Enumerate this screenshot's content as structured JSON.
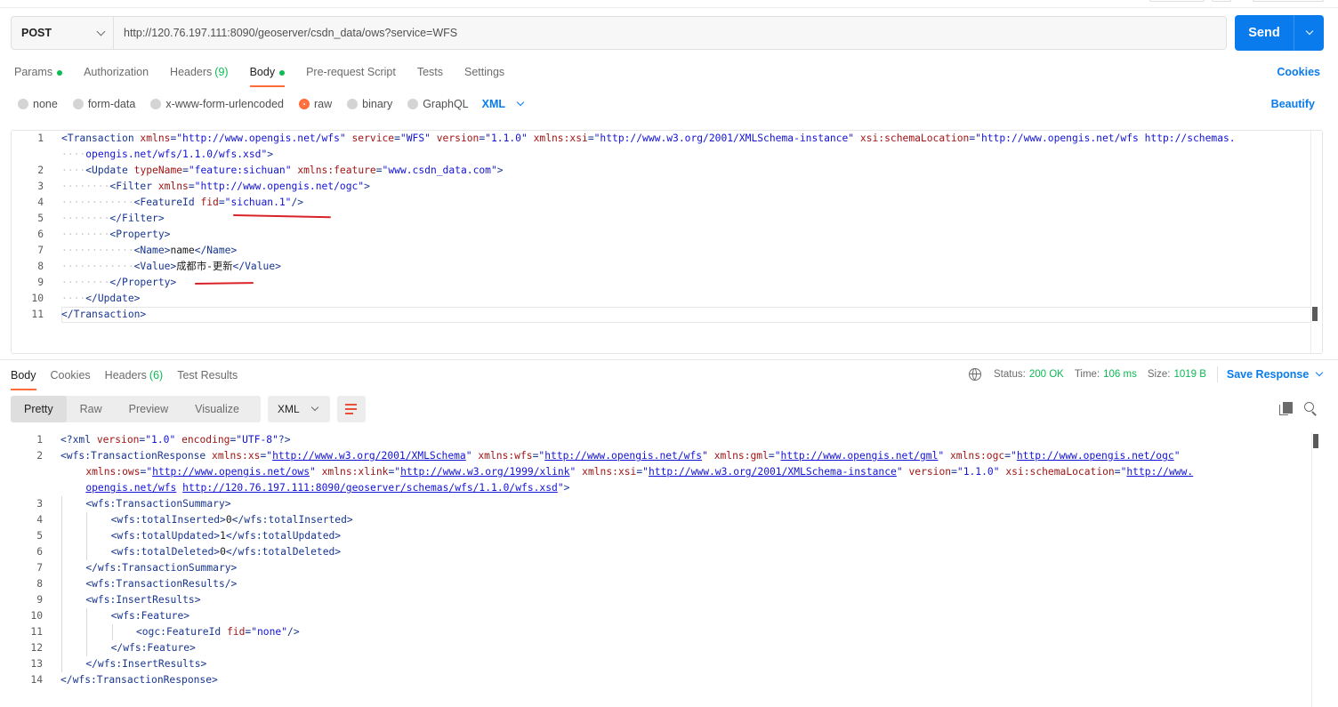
{
  "request": {
    "method": "POST",
    "url": "http://120.76.197.111:8090/geoserver/csdn_data/ows?service=WFS",
    "send_label": "Send"
  },
  "request_tabs": [
    {
      "label": "Params",
      "dot": true
    },
    {
      "label": "Authorization"
    },
    {
      "label": "Headers",
      "count": "(9)"
    },
    {
      "label": "Body",
      "dot": true,
      "active": true
    },
    {
      "label": "Pre-request Script"
    },
    {
      "label": "Tests"
    },
    {
      "label": "Settings"
    }
  ],
  "cookies_label": "Cookies",
  "body_types": [
    {
      "label": "none"
    },
    {
      "label": "form-data"
    },
    {
      "label": "x-www-form-urlencoded"
    },
    {
      "label": "raw",
      "selected": true
    },
    {
      "label": "binary"
    },
    {
      "label": "GraphQL"
    }
  ],
  "body_language": "XML",
  "beautify_label": "Beautify",
  "request_lines": [
    {
      "n": "1",
      "indent": 0,
      "parts": [
        [
          "tg",
          "<Transaction "
        ],
        [
          "at",
          "xmlns"
        ],
        [
          "tg",
          "="
        ],
        [
          "vl",
          "\"http://www.opengis.net/wfs\""
        ],
        [
          "tg",
          " "
        ],
        [
          "at",
          "service"
        ],
        [
          "tg",
          "="
        ],
        [
          "vl",
          "\"WFS\""
        ],
        [
          "tg",
          " "
        ],
        [
          "at",
          "version"
        ],
        [
          "tg",
          "="
        ],
        [
          "vl",
          "\"1.1.0\""
        ],
        [
          "tg",
          " "
        ],
        [
          "at",
          "xmlns:xsi"
        ],
        [
          "tg",
          "="
        ],
        [
          "vl",
          "\"http://www.w3.org/2001/XMLSchema-instance\""
        ],
        [
          "tg",
          " "
        ],
        [
          "at",
          "xsi:schemaLocation"
        ],
        [
          "tg",
          "="
        ],
        [
          "vl",
          "\"http://www.opengis.net/wfs http://schemas."
        ]
      ]
    },
    {
      "n": "",
      "indent": 4,
      "parts": [
        [
          "vl",
          "opengis.net/wfs/1.1.0/wfs.xsd\""
        ],
        [
          "tg",
          ">"
        ]
      ]
    },
    {
      "n": "2",
      "indent": 4,
      "parts": [
        [
          "tg",
          "<Update "
        ],
        [
          "at",
          "typeName"
        ],
        [
          "tg",
          "="
        ],
        [
          "vl",
          "\"feature:sichuan\""
        ],
        [
          "tg",
          " "
        ],
        [
          "at",
          "xmlns:feature"
        ],
        [
          "tg",
          "="
        ],
        [
          "vl",
          "\"www.csdn_data.com\""
        ],
        [
          "tg",
          ">"
        ]
      ]
    },
    {
      "n": "3",
      "indent": 8,
      "parts": [
        [
          "tg",
          "<Filter "
        ],
        [
          "at",
          "xmlns"
        ],
        [
          "tg",
          "="
        ],
        [
          "vl",
          "\"http://www.opengis.net/ogc\""
        ],
        [
          "tg",
          ">"
        ]
      ]
    },
    {
      "n": "4",
      "indent": 12,
      "parts": [
        [
          "tg",
          "<FeatureId "
        ],
        [
          "at",
          "fid"
        ],
        [
          "tg",
          "="
        ],
        [
          "vl",
          "\"sichuan.1\""
        ],
        [
          "tg",
          "/>"
        ]
      ]
    },
    {
      "n": "5",
      "indent": 8,
      "parts": [
        [
          "tg",
          "</Filter>"
        ]
      ]
    },
    {
      "n": "6",
      "indent": 8,
      "parts": [
        [
          "tg",
          "<Property>"
        ]
      ]
    },
    {
      "n": "7",
      "indent": 12,
      "parts": [
        [
          "tg",
          "<Name>"
        ],
        [
          "tx",
          "name"
        ],
        [
          "tg",
          "</Name>"
        ]
      ]
    },
    {
      "n": "8",
      "indent": 12,
      "parts": [
        [
          "tg",
          "<Value>"
        ],
        [
          "tx",
          "成都市-更新"
        ],
        [
          "tg",
          "</Value>"
        ]
      ]
    },
    {
      "n": "9",
      "indent": 8,
      "parts": [
        [
          "tg",
          "</Property>"
        ]
      ]
    },
    {
      "n": "10",
      "indent": 4,
      "parts": [
        [
          "tg",
          "</Update>"
        ]
      ]
    },
    {
      "n": "11",
      "indent": 0,
      "parts": [
        [
          "tg",
          "</Transaction>"
        ]
      ]
    }
  ],
  "response_tabs": [
    {
      "label": "Body",
      "active": true
    },
    {
      "label": "Cookies"
    },
    {
      "label": "Headers",
      "count": "(6)"
    },
    {
      "label": "Test Results"
    }
  ],
  "status": {
    "status_label": "Status:",
    "status_value": "200 OK",
    "time_label": "Time:",
    "time_value": "106 ms",
    "size_label": "Size:",
    "size_value": "1019 B",
    "save_response": "Save Response"
  },
  "view_modes": [
    {
      "label": "Pretty",
      "active": true
    },
    {
      "label": "Raw"
    },
    {
      "label": "Preview"
    },
    {
      "label": "Visualize"
    }
  ],
  "response_format": "XML",
  "response_lines": [
    {
      "n": "1",
      "indent": 0,
      "parts": [
        [
          "tg",
          "<?xml "
        ],
        [
          "at",
          "version"
        ],
        [
          "tg",
          "="
        ],
        [
          "vl",
          "\"1.0\""
        ],
        [
          "tg",
          " "
        ],
        [
          "at",
          "encoding"
        ],
        [
          "tg",
          "="
        ],
        [
          "vl",
          "\"UTF-8\""
        ],
        [
          "tg",
          "?>"
        ]
      ]
    },
    {
      "n": "2",
      "indent": 0,
      "parts": [
        [
          "tg",
          "<wfs:TransactionResponse "
        ],
        [
          "at",
          "xmlns:xs"
        ],
        [
          "tg",
          "="
        ],
        [
          "vl",
          "\""
        ],
        [
          "vu",
          "http://www.w3.org/2001/XMLSchema"
        ],
        [
          "vl",
          "\""
        ],
        [
          "tg",
          " "
        ],
        [
          "at",
          "xmlns:wfs"
        ],
        [
          "tg",
          "="
        ],
        [
          "vl",
          "\""
        ],
        [
          "vu",
          "http://www.opengis.net/wfs"
        ],
        [
          "vl",
          "\""
        ],
        [
          "tg",
          " "
        ],
        [
          "at",
          "xmlns:gml"
        ],
        [
          "tg",
          "="
        ],
        [
          "vl",
          "\""
        ],
        [
          "vu",
          "http://www.opengis.net/gml"
        ],
        [
          "vl",
          "\""
        ],
        [
          "tg",
          " "
        ],
        [
          "at",
          "xmlns:ogc"
        ],
        [
          "tg",
          "="
        ],
        [
          "vl",
          "\""
        ],
        [
          "vu",
          "http://www.opengis.net/ogc"
        ],
        [
          "vl",
          "\""
        ]
      ]
    },
    {
      "n": "",
      "indent": 4,
      "parts": [
        [
          "at",
          "xmlns:ows"
        ],
        [
          "tg",
          "="
        ],
        [
          "vl",
          "\""
        ],
        [
          "vu",
          "http://www.opengis.net/ows"
        ],
        [
          "vl",
          "\""
        ],
        [
          "tg",
          " "
        ],
        [
          "at",
          "xmlns:xlink"
        ],
        [
          "tg",
          "="
        ],
        [
          "vl",
          "\""
        ],
        [
          "vu",
          "http://www.w3.org/1999/xlink"
        ],
        [
          "vl",
          "\""
        ],
        [
          "tg",
          " "
        ],
        [
          "at",
          "xmlns:xsi"
        ],
        [
          "tg",
          "="
        ],
        [
          "vl",
          "\""
        ],
        [
          "vu",
          "http://www.w3.org/2001/XMLSchema-instance"
        ],
        [
          "vl",
          "\""
        ],
        [
          "tg",
          " "
        ],
        [
          "at",
          "version"
        ],
        [
          "tg",
          "="
        ],
        [
          "vl",
          "\"1.1.0\""
        ],
        [
          "tg",
          " "
        ],
        [
          "at",
          "xsi:schemaLocation"
        ],
        [
          "tg",
          "="
        ],
        [
          "vl",
          "\""
        ],
        [
          "vu",
          "http://www."
        ]
      ]
    },
    {
      "n": "",
      "indent": 4,
      "parts": [
        [
          "vu",
          "opengis.net/wfs"
        ],
        [
          "tg",
          " "
        ],
        [
          "vu",
          "http://120.76.197.111:8090/geoserver/schemas/wfs/1.1.0/wfs.xsd"
        ],
        [
          "vl",
          "\""
        ],
        [
          "tg",
          ">"
        ]
      ]
    },
    {
      "n": "3",
      "indent": 4,
      "parts": [
        [
          "tg",
          "<wfs:TransactionSummary>"
        ]
      ]
    },
    {
      "n": "4",
      "indent": 8,
      "parts": [
        [
          "tg",
          "<wfs:totalInserted>"
        ],
        [
          "tx",
          "0"
        ],
        [
          "tg",
          "</wfs:totalInserted>"
        ]
      ]
    },
    {
      "n": "5",
      "indent": 8,
      "parts": [
        [
          "tg",
          "<wfs:totalUpdated>"
        ],
        [
          "tx",
          "1"
        ],
        [
          "tg",
          "</wfs:totalUpdated>"
        ]
      ]
    },
    {
      "n": "6",
      "indent": 8,
      "parts": [
        [
          "tg",
          "<wfs:totalDeleted>"
        ],
        [
          "tx",
          "0"
        ],
        [
          "tg",
          "</wfs:totalDeleted>"
        ]
      ]
    },
    {
      "n": "7",
      "indent": 4,
      "parts": [
        [
          "tg",
          "</wfs:TransactionSummary>"
        ]
      ]
    },
    {
      "n": "8",
      "indent": 4,
      "parts": [
        [
          "tg",
          "<wfs:TransactionResults/>"
        ]
      ]
    },
    {
      "n": "9",
      "indent": 4,
      "parts": [
        [
          "tg",
          "<wfs:InsertResults>"
        ]
      ]
    },
    {
      "n": "10",
      "indent": 8,
      "parts": [
        [
          "tg",
          "<wfs:Feature>"
        ]
      ]
    },
    {
      "n": "11",
      "indent": 12,
      "parts": [
        [
          "tg",
          "<ogc:FeatureId "
        ],
        [
          "at",
          "fid"
        ],
        [
          "tg",
          "="
        ],
        [
          "vl",
          "\"none\""
        ],
        [
          "tg",
          "/>"
        ]
      ]
    },
    {
      "n": "12",
      "indent": 8,
      "parts": [
        [
          "tg",
          "</wfs:Feature>"
        ]
      ]
    },
    {
      "n": "13",
      "indent": 4,
      "parts": [
        [
          "tg",
          "</wfs:InsertResults>"
        ]
      ]
    },
    {
      "n": "14",
      "indent": 0,
      "parts": [
        [
          "tg",
          "</wfs:TransactionResponse>"
        ]
      ]
    }
  ]
}
